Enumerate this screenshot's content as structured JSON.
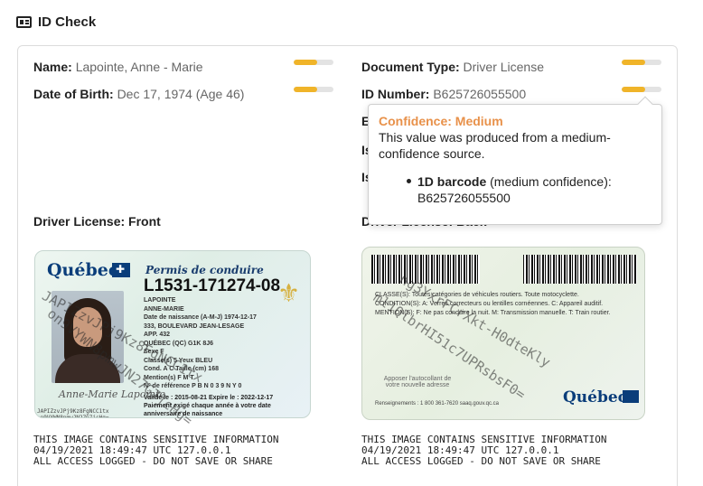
{
  "header": {
    "title": "ID Check",
    "icon": "id-card-icon"
  },
  "fields": {
    "name": {
      "label": "Name:",
      "value": "Lapointe, Anne - Marie",
      "confidence": 0.6
    },
    "dob": {
      "label": "Date of Birth:",
      "value": "Dec 17, 1974 (Age 46)",
      "confidence": 0.6
    },
    "doc_type": {
      "label": "Document Type:",
      "value": "Driver License",
      "confidence": 0.6
    },
    "id_number": {
      "label": "ID Number:",
      "value": "B625726055500",
      "confidence": 0.6
    },
    "hidden_1": "E",
    "hidden_2": "Is",
    "hidden_3": "Is"
  },
  "sections": {
    "front_title": "Driver License: Front",
    "back_title": "Driver License: Back"
  },
  "tooltip": {
    "title": "Confidence: Medium",
    "description": "This value was produced from a medium-confidence source.",
    "source_name": "1D barcode",
    "source_detail": "(medium confidence): B625726055500"
  },
  "front_card": {
    "province": "Québec",
    "heading": "Permis de conduire",
    "license_number": "L1531-171274-08",
    "lines": [
      "LAPOINTE",
      "ANNE-MARIE",
      "Date de naissance (A-M-J)  1974-12-17",
      "333, BOULEVARD JEAN-LESAGE",
      "APP. 432",
      "QUÉBEC (QC) G1K 8J6",
      "Sexe  F",
      "Classe(s)  5  Yeux  BLEU",
      "Cond.  A C  Taille (cm)  168",
      "Mention(s)  F M T",
      "Nº de référence  P B N 0 3 9 N Y 0",
      "Valide le : 2015-08-21   Expire le : 2022-12-17"
    ],
    "footer": "Paiement exigé chaque année à votre date anniversaire de naissance",
    "signature": "Anne-Marie Lapointe",
    "tiny_text": "JAPIZzvJPj9Kz8FgNCC1tx\non9VYWN8pmwJN27G7jcHg="
  },
  "back_card": {
    "lines": [
      "CLASSE(S): Toutes catégories de véhicules routiers. Toute motocyclette.",
      "CONDITION(S): A: Verres correcteurs ou lentilles cornéennes. C: Appareil auditif.",
      "MENTION(S): F: Ne pas conduire la nuit. M: Transmission manuelle. T: Train routier."
    ],
    "address_box": "Apposer l'autocollant de votre nouvelle adresse",
    "province": "Québec",
    "info": "Renseignements : 1 800 361-7620   saaq.gouv.qc.ca"
  },
  "warning": "THIS IMAGE CONTAINS SENSITIVE INFORMATION\n04/19/2021 18:49:47 UTC 127.0.0.1\nALL ACCESS LOGGED - DO NOT SAVE OR SHARE",
  "watermarks": [
    "JAPIZzvJPj9Kz8FgNCC1tx",
    "on9VYWN8pmwJN27G7jcHg=",
    "ng3YxrFCrXkt-H0dteKly",
    "ml1QlbrHI51c7UPRsbsF0="
  ],
  "colors": {
    "meter": "#f0b429",
    "tooltip_title": "#e8914a"
  }
}
